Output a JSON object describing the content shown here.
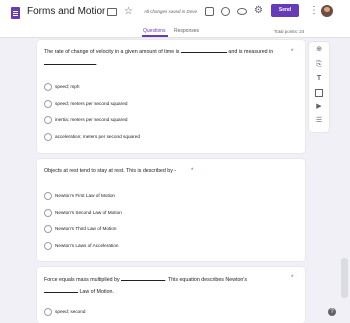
{
  "header": {
    "title": "Forms and Motion Qu",
    "saved_status": "All changes saved in Drive",
    "send_label": "Send",
    "icons": [
      "folder-icon",
      "star-icon",
      "palette-icon",
      "theme-icon",
      "eye-icon",
      "gear-icon",
      "more-vert-icon",
      "avatar"
    ]
  },
  "tabs": {
    "questions": "Questions",
    "responses": "Responses",
    "total_points": "Total points: 24"
  },
  "questions": [
    {
      "text_before": "The rate of change of velocity in a given amount of time is",
      "text_middle": "and is measured in",
      "text_after": ".",
      "required_mark": "*",
      "options": [
        "speed; mph",
        "speed; meters per second squared",
        "inertia; meters per second squared",
        "acceleration; meters per second squared"
      ]
    },
    {
      "text": "Objects at rest tend to stay at rest.  This is described by -",
      "required_mark": "*",
      "options": [
        "Newton's First Law of Motion",
        "Newton's Second Law of Motion",
        "Newton's Third Law of Motion",
        "Newton's Laws of Acceleration"
      ]
    },
    {
      "text_before": "Force equals mass multiplied by",
      "text_middle": ". This equation describes Newton's",
      "text_after": "Law of Motion.",
      "required_mark": "*",
      "options": [
        "speed; second"
      ]
    }
  ],
  "sidebar_tools": [
    "add-question-icon",
    "import-questions-icon",
    "title-icon",
    "image-icon",
    "video-icon",
    "section-icon"
  ],
  "colors": {
    "accent": "#673ab7",
    "background": "#f1f0f6"
  }
}
